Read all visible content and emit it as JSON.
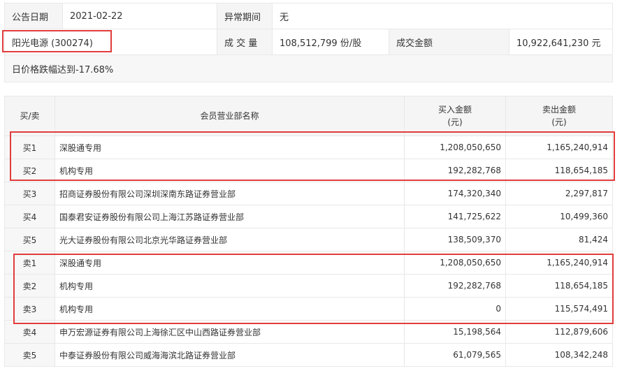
{
  "info": {
    "date_label": "公告日期",
    "date_value": "2021-02-22",
    "period_label": "异常期间",
    "period_value": "无",
    "stock_name": "阳光电源 (300274)",
    "volume_label": "成 交 量",
    "volume_value": "108,512,799 份/股",
    "amount_label": "成交金额",
    "amount_value": "10,922,641,230 元",
    "reason": "日价格跌幅达到-17.68%"
  },
  "table": {
    "headers": {
      "side": "买/卖",
      "name": "会员营业部名称",
      "buy_line1": "买入金额",
      "buy_line2": "(元)",
      "sell_line1": "卖出金额",
      "sell_line2": "(元)"
    },
    "rows": [
      {
        "side": "买1",
        "name": "深股通专用",
        "buy": "1,208,050,650",
        "sell": "1,165,240,914"
      },
      {
        "side": "买2",
        "name": "机构专用",
        "buy": "192,282,768",
        "sell": "118,654,185"
      },
      {
        "side": "买3",
        "name": "招商证券股份有限公司深圳深南东路证券营业部",
        "buy": "174,320,340",
        "sell": "2,297,817"
      },
      {
        "side": "买4",
        "name": "国泰君安证券股份有限公司上海江苏路证券营业部",
        "buy": "141,725,622",
        "sell": "10,499,360"
      },
      {
        "side": "买5",
        "name": "光大证券股份有限公司北京光华路证券营业部",
        "buy": "138,509,370",
        "sell": "81,424"
      },
      {
        "side": "卖1",
        "name": "深股通专用",
        "buy": "1,208,050,650",
        "sell": "1,165,240,914"
      },
      {
        "side": "卖2",
        "name": "机构专用",
        "buy": "192,282,768",
        "sell": "118,654,185"
      },
      {
        "side": "卖3",
        "name": "机构专用",
        "buy": "0",
        "sell": "115,574,491"
      },
      {
        "side": "卖4",
        "name": "申万宏源证券有限公司上海徐汇区中山西路证券营业部",
        "buy": "15,198,564",
        "sell": "112,879,606"
      },
      {
        "side": "卖5",
        "name": "中泰证券股份有限公司威海海滨北路证券营业部",
        "buy": "61,079,565",
        "sell": "108,342,248"
      }
    ]
  },
  "highlight_color": "#e23c3c"
}
